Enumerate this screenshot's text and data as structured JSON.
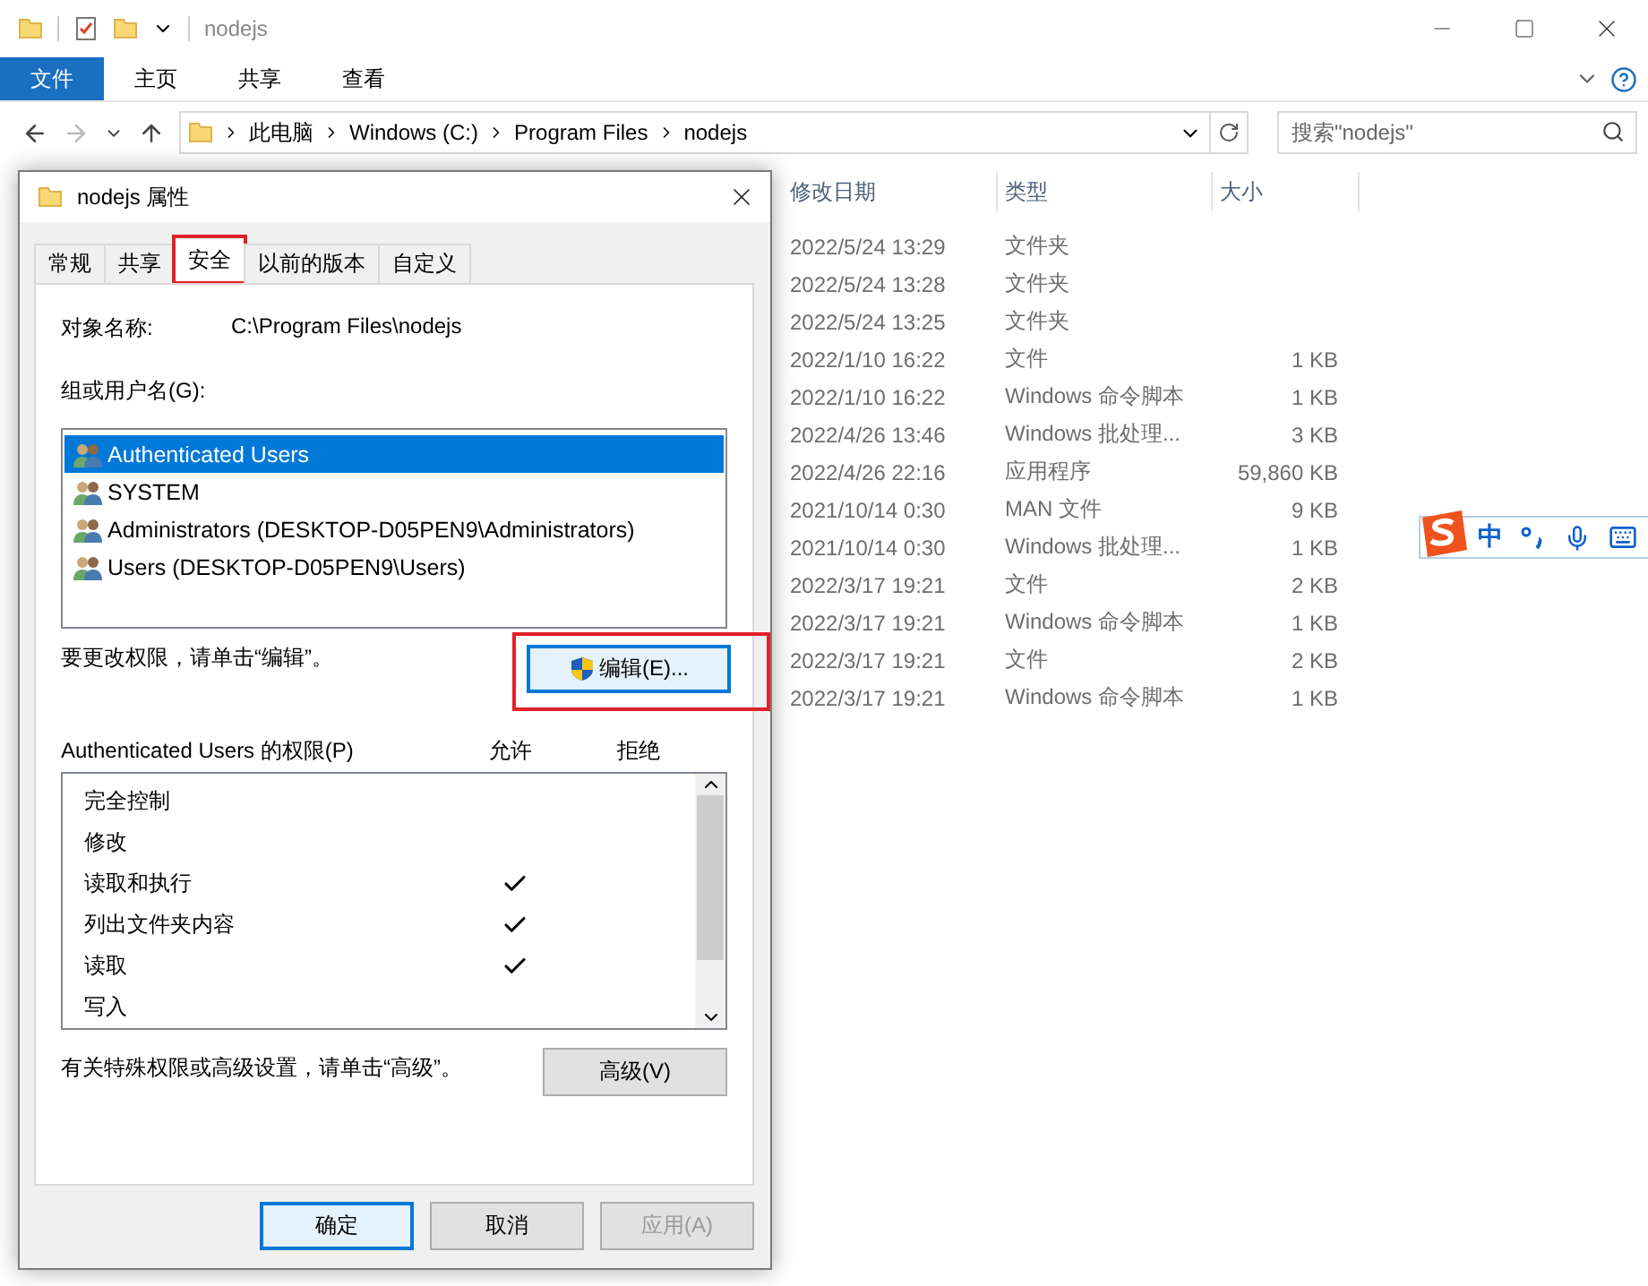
{
  "explorer": {
    "title": "nodejs",
    "ribbon_tabs": [
      {
        "label": "文件",
        "selected": true
      },
      {
        "label": "主页",
        "selected": false
      },
      {
        "label": "共享",
        "selected": false
      },
      {
        "label": "查看",
        "selected": false
      }
    ],
    "breadcrumb": [
      "此电脑",
      "Windows (C:)",
      "Program Files",
      "nodejs"
    ],
    "search": {
      "placeholder": "搜索\"nodejs\""
    },
    "columns": [
      "修改日期",
      "类型",
      "大小"
    ],
    "rows": [
      {
        "date": "2022/5/24 13:29",
        "type": "文件夹"
      },
      {
        "date": "2022/5/24 13:28",
        "type": "文件夹"
      },
      {
        "date": "2022/5/24 13:25",
        "type": "文件夹"
      },
      {
        "date": "2022/1/10 16:22",
        "type": "文件",
        "size": "1 KB"
      },
      {
        "date": "2022/1/10 16:22",
        "type": "Windows 命令脚本",
        "size": "1 KB"
      },
      {
        "date": "2022/4/26 13:46",
        "type": "Windows 批处理...",
        "size": "3 KB"
      },
      {
        "date": "2022/4/26 22:16",
        "type": "应用程序",
        "size": "59,860 KB"
      },
      {
        "date": "2021/10/14 0:30",
        "type": "MAN 文件",
        "size": "9 KB"
      },
      {
        "date": "2021/10/14 0:30",
        "type": "Windows 批处理...",
        "size": "1 KB"
      },
      {
        "date": "2022/3/17 19:21",
        "type": "文件",
        "size": "2 KB"
      },
      {
        "date": "2022/3/17 19:21",
        "type": "Windows 命令脚本",
        "size": "1 KB"
      },
      {
        "date": "2022/3/17 19:21",
        "type": "文件",
        "size": "2 KB"
      },
      {
        "date": "2022/3/17 19:21",
        "type": "Windows 命令脚本",
        "size": "1 KB"
      }
    ]
  },
  "dialog": {
    "title": "nodejs 属性",
    "tabs": [
      {
        "label": "常规",
        "selected": false
      },
      {
        "label": "共享",
        "selected": false
      },
      {
        "label": "安全",
        "selected": true
      },
      {
        "label": "以前的版本",
        "selected": false
      },
      {
        "label": "自定义",
        "selected": false
      }
    ],
    "object_label": "对象名称:",
    "object_value": "C:\\Program Files\\nodejs",
    "group_label": "组或用户名(G):",
    "users": [
      {
        "name": "Authenticated Users",
        "selected": true
      },
      {
        "name": "SYSTEM",
        "selected": false
      },
      {
        "name": "Administrators (DESKTOP-D05PEN9\\Administrators)",
        "selected": false
      },
      {
        "name": "Users (DESKTOP-D05PEN9\\Users)",
        "selected": false
      }
    ],
    "edit_hint": "要更改权限，请单击“编辑”。",
    "edit_button": "编辑(E)...",
    "permissions_label": "Authenticated Users 的权限(P)",
    "allow_header": "允许",
    "deny_header": "拒绝",
    "permissions": [
      {
        "name": "完全控制",
        "allow": false
      },
      {
        "name": "修改",
        "allow": false
      },
      {
        "name": "读取和执行",
        "allow": true
      },
      {
        "name": "列出文件夹内容",
        "allow": true
      },
      {
        "name": "读取",
        "allow": true
      },
      {
        "name": "写入",
        "allow": false
      }
    ],
    "advanced_hint": "有关特殊权限或高级设置，请单击“高级”。",
    "advanced_button": "高级(V)",
    "buttons": [
      {
        "label": "确定",
        "default": true,
        "disabled": false
      },
      {
        "label": "取消",
        "default": false,
        "disabled": false
      },
      {
        "label": "应用(A)",
        "default": false,
        "disabled": true
      }
    ]
  },
  "ime": {
    "mode": "中"
  }
}
